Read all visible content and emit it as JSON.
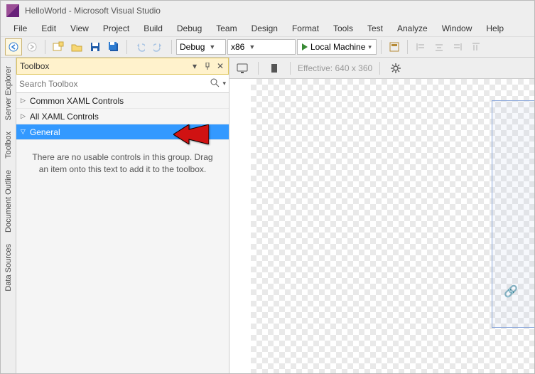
{
  "title": "HelloWorld - Microsoft Visual Studio",
  "menu": [
    "File",
    "Edit",
    "View",
    "Project",
    "Build",
    "Debug",
    "Team",
    "Design",
    "Format",
    "Tools",
    "Test",
    "Analyze",
    "Window",
    "Help"
  ],
  "toolbar": {
    "config_label": "Debug",
    "platform_label": "x86",
    "start_label": "Local Machine"
  },
  "sidetabs": [
    "Server Explorer",
    "Toolbox",
    "Document Outline",
    "Data Sources"
  ],
  "toolbox": {
    "title": "Toolbox",
    "search_placeholder": "Search Toolbox",
    "categories": [
      {
        "label": "Common XAML Controls",
        "expanded": false,
        "selected": false
      },
      {
        "label": "All XAML Controls",
        "expanded": false,
        "selected": false
      },
      {
        "label": "General",
        "expanded": true,
        "selected": true
      }
    ],
    "empty_text": "There are no usable controls in this group. Drag an item onto this text to add it to the toolbox."
  },
  "designer": {
    "effective_label": "Effective: 640 x 360"
  }
}
